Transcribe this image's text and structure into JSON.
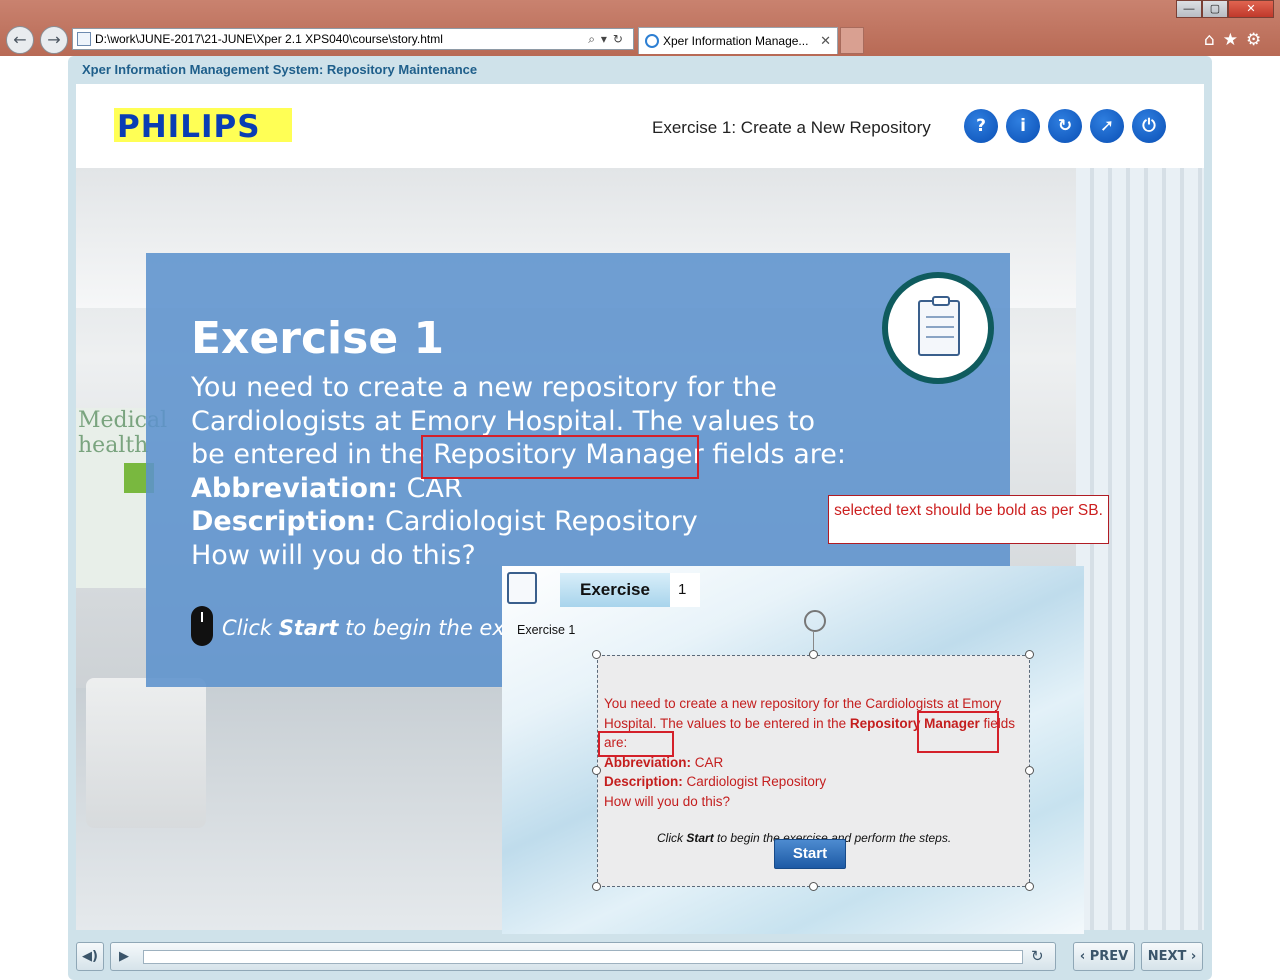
{
  "browser": {
    "address": "D:\\work\\JUNE-2017\\21-JUNE\\Xper 2.1 XPS040\\course\\story.html",
    "tab_title": "Xper Information Manage...",
    "back_icon": "back-arrow-icon",
    "forward_icon": "forward-arrow-icon"
  },
  "course": {
    "title": "Xper Information Management System: Repository Maintenance",
    "logo_text": "PHILIPS",
    "exercise_title": "Exercise 1: Create a New Repository",
    "header_buttons": [
      "help-icon",
      "info-icon",
      "replay-icon",
      "compass-icon",
      "power-icon"
    ],
    "brand_color": "#0a3db4"
  },
  "slide": {
    "heading": "Exercise 1",
    "line1": "You need to create a new repository for the",
    "line2": "Cardiologists at Emory Hospital. The values to",
    "line3a": "be entered in the ",
    "line3b": "Repository Manager",
    "line3c": " fields are:",
    "abbr_label": "Abbreviation:",
    "abbr_value": " CAR",
    "desc_label": "Description:",
    "desc_value": " Cardiologist Repository",
    "question": "How will you do this?",
    "click_pre": "Click ",
    "click_start": "Start",
    "click_post": " to begin the exerc",
    "background_sign": "Medical health"
  },
  "comment": {
    "text": "selected text should be bold as per SB.",
    "color": "#cc1f1f"
  },
  "inset": {
    "tab_label": "Exercise",
    "tab_number": "1",
    "label": "Exercise 1",
    "p1": "You need to create a new repository for the Cardiologists at Emory Hospital. The values to be entered in the ",
    "p1_bold": "Repository Manager",
    "p1_end": " fields are:",
    "abbr_label": "Abbreviation:",
    "abbr_value": " CAR",
    "desc_label": "Description:",
    "desc_value": " Cardiologist Repository",
    "question": "How will you do this?",
    "click_pre": "Click ",
    "click_start": "Start",
    "click_post": " to begin the exercise and perform the steps.",
    "start_button": "Start"
  },
  "controls": {
    "prev_label": "PREV",
    "next_label": "NEXT"
  }
}
